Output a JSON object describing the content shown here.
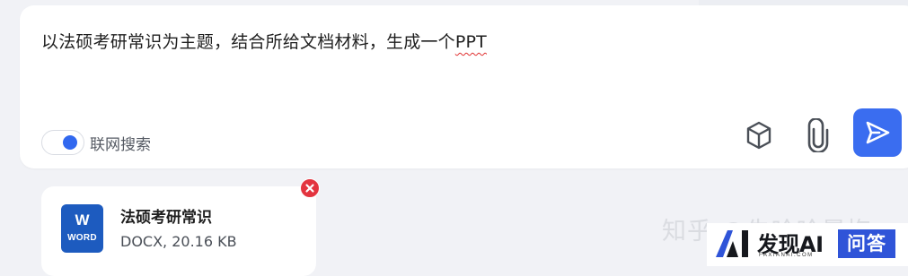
{
  "input": {
    "prompt_main": "以法硕考研常识为主题，结合所给文档材料，生成一个",
    "prompt_ppt": "PPT"
  },
  "toolbar": {
    "web_search_label": "联网搜索",
    "web_search_enabled": true,
    "cube_icon": "cube-icon",
    "attach_icon": "paperclip-icon",
    "send_icon": "send-icon",
    "accent_color": "#3a6df0"
  },
  "attachment": {
    "icon_letter": "W",
    "icon_label": "WORD",
    "name": "法硕考研常识",
    "meta": "DOCX, 20.16 KB",
    "remove_icon": "close-icon",
    "remove_color": "#e3343f"
  },
  "watermarks": {
    "zhihu": "知乎 @朱哈哈晨梅",
    "brand_name": "发现AI",
    "brand_sub": "FAXIANAI.COM",
    "brand_tag": "问答"
  }
}
